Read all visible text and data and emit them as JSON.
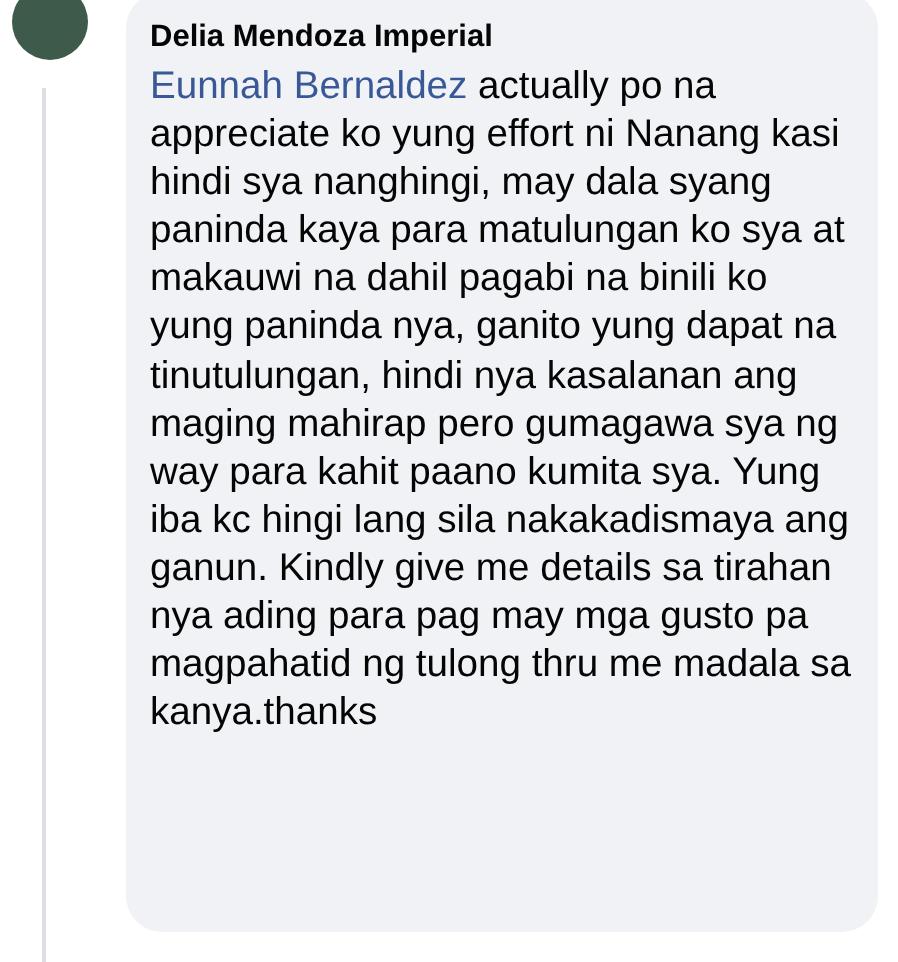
{
  "comment": {
    "author": "Delia Mendoza Imperial",
    "mention": "Eunnah Bernaldez",
    "text": "actually po na appreciate ko yung effort ni Nanang kasi hindi sya nanghingi, may dala syang paninda kaya para matulungan ko sya at makauwi na dahil pagabi na binili ko yung paninda nya, ganito yung dapat na tinutulungan, hindi nya kasalanan ang maging mahirap pero gumagawa sya ng way para kahit paano kumita sya. Yung iba kc hingi lang sila nakakadismaya ang ganun. Kindly give me details sa tirahan nya ading para pag may mga gusto pa magpahatid ng tulong thru me madala sa kanya.thanks"
  }
}
